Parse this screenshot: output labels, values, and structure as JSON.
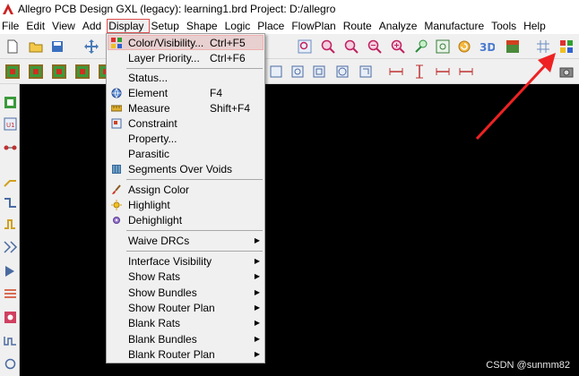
{
  "window": {
    "title": "Allegro PCB Design GXL (legacy): learning1.brd  Project: D:/allegro"
  },
  "menubar": [
    {
      "label": "File"
    },
    {
      "label": "Edit"
    },
    {
      "label": "View"
    },
    {
      "label": "Add"
    },
    {
      "label": "Display",
      "active": true
    },
    {
      "label": "Setup"
    },
    {
      "label": "Shape"
    },
    {
      "label": "Logic"
    },
    {
      "label": "Place"
    },
    {
      "label": "FlowPlan"
    },
    {
      "label": "Route"
    },
    {
      "label": "Analyze"
    },
    {
      "label": "Manufacture"
    },
    {
      "label": "Tools"
    },
    {
      "label": "Help"
    }
  ],
  "display_menu": {
    "items": [
      {
        "label": "Color/Visibility...",
        "shortcut": "Ctrl+F5",
        "icon": "color-grid-icon",
        "highlighted": true
      },
      {
        "label": "Layer Priority...",
        "shortcut": "Ctrl+F6"
      },
      {
        "label": "Status..."
      },
      {
        "label": "Element",
        "shortcut": "F4",
        "icon": "globe-icon"
      },
      {
        "label": "Measure",
        "shortcut": "Shift+F4",
        "icon": "ruler-icon"
      },
      {
        "label": "Constraint",
        "icon": "constraint-icon"
      },
      {
        "label": "Property..."
      },
      {
        "label": "Parasitic"
      },
      {
        "label": "Segments Over Voids",
        "icon": "segments-icon"
      },
      {
        "label": "Assign Color",
        "icon": "brush-icon"
      },
      {
        "label": "Highlight",
        "icon": "sun-icon"
      },
      {
        "label": "Dehighlight",
        "icon": "gear-sun-icon"
      },
      {
        "label": "Waive DRCs",
        "submenu": true
      },
      {
        "label": "Interface Visibility",
        "submenu": true
      },
      {
        "label": "Show Rats",
        "submenu": true
      },
      {
        "label": "Show Bundles",
        "submenu": true
      },
      {
        "label": "Show Router Plan",
        "submenu": true
      },
      {
        "label": "Blank Rats",
        "submenu": true
      },
      {
        "label": "Blank Bundles",
        "submenu": true
      },
      {
        "label": "Blank Router Plan",
        "submenu": true
      }
    ]
  },
  "toolbar": {
    "icons_row1": [
      "new-file-icon",
      "open-folder-icon",
      "save-icon",
      "move-icon",
      "zoom-fit-icon",
      "zoom-in-icon",
      "zoom-out-icon",
      "zoom-world-icon",
      "zoom-prev-icon",
      "refresh-icon",
      "3d-view-icon",
      "flip-icon",
      "grid-icon",
      "color-visibility-icon"
    ],
    "icons_row2": [
      "layer-icon",
      "layer-icon",
      "layer-icon",
      "layer-icon",
      "layer-icon",
      "shape-icon",
      "shape-icon",
      "shape-icon",
      "shape-icon",
      "shape-icon",
      "measure-icon",
      "measure-icon",
      "measure-icon",
      "measure-icon",
      "camera-icon"
    ],
    "icon_text_3d": "3D"
  },
  "left_toolbar": {
    "icons": [
      "component-icon",
      "part-icon",
      "net-icon",
      "route-icon",
      "route-icon",
      "route-icon",
      "route-icon",
      "route-icon",
      "route-icon",
      "route-icon",
      "route-icon",
      "route-icon"
    ]
  },
  "watermark": "CSDN @sunmm82",
  "colors": {
    "canvas": "#000000",
    "menu_bg": "#f0f0f0",
    "highlight": "#e8d0d0",
    "arrow": "#ee2222",
    "active_menu_outline": "#e05050"
  }
}
